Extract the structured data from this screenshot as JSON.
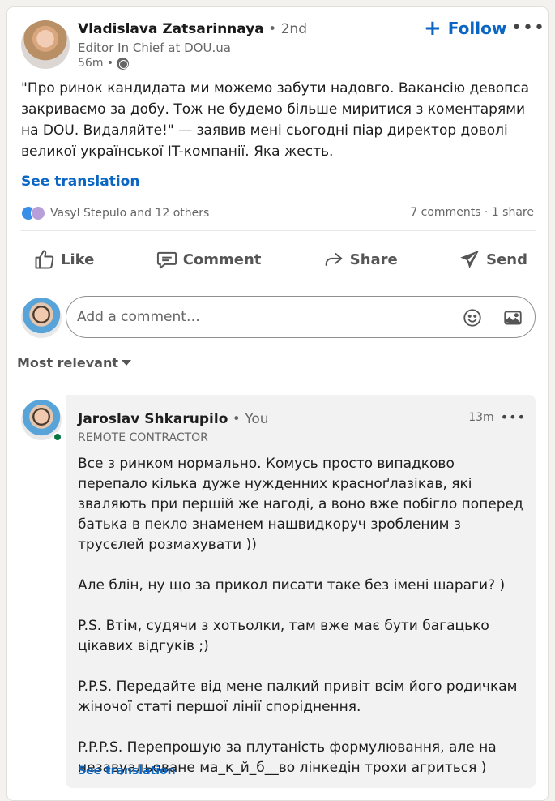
{
  "post": {
    "author": {
      "name": "Vladislava Zatsarinnaya",
      "degree": " • 2nd",
      "title": "Editor In Chief at DOU.ua",
      "time": "56m •",
      "avatar": "avatar-photo"
    },
    "follow_label": "Follow",
    "follow_icon": "plus-icon",
    "more_icon": "more-icon",
    "text": "\"Про ринок кандидата ми можемо забути надовго. Вакансію девопса закриваємо за добу. Тож не будемо більше миритися з коментарями на DOU. Видаляйте!\" — заявив мені сьогодні піар директор доволі великої української IT-компанії. Яка жесть.",
    "see_translation": "See translation",
    "reactions_text": "Vasyl Stepulo and 12 others",
    "counts_text": "7 comments · 1 share"
  },
  "actions": {
    "like": "Like",
    "comment": "Comment",
    "share": "Share",
    "send": "Send"
  },
  "comment_box": {
    "placeholder": "Add a comment…",
    "emoji_icon": "emoji-icon",
    "image_icon": "image-icon"
  },
  "sort": {
    "label": "Most relevant"
  },
  "comment": {
    "name": "Jaroslav Shkarupilo",
    "you_tag": " • You",
    "title": "REMOTE CONTRACTOR",
    "time": "13m",
    "more": "•••",
    "text": "Все з ринком нормально. Комусь просто випадково перепало кілька дуже нужденних красноґлазікав, які зваляють при першій же нагоді, а воно вже побігло поперед батька в пекло знаменем нашвидкоруч зробленим з трусєлей розмахувати ))\n\nАле блін, ну що за прикол писати таке без імені шараги? )\n\nP.S. Втім, судячи з хотьолки, там вже має бути багацько цікавих відгуків ;)\n\nP.P.S. Передайте від мене палкий привіт всім його родичкам жіночої статі першої лінії споріднення.\n\nP.P.P.S. Перепрошую за плутаність формулювання, але на незавуальоване ма_к_й_б__во лінкедін трохи агриться )",
    "see_translation": "See translation"
  },
  "colors": {
    "link": "#0a66c2",
    "online": "#057642",
    "like_reaction": "#378fe9",
    "love_reaction": "#b79fda"
  }
}
